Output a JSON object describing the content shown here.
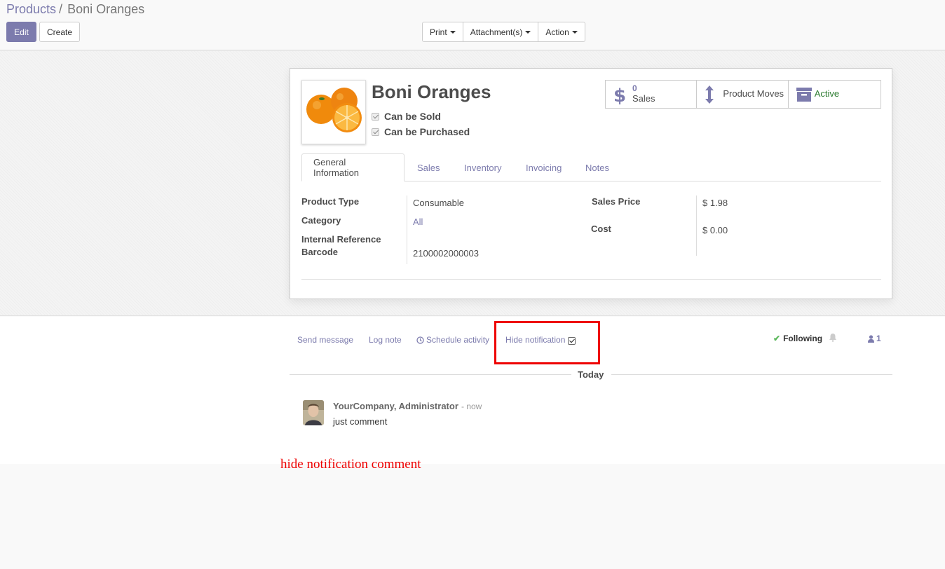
{
  "breadcrumb": {
    "parent": "Products",
    "separator": "/",
    "current": "Boni Oranges"
  },
  "toolbar": {
    "edit": "Edit",
    "create": "Create",
    "print": "Print",
    "attachments": "Attachment(s)",
    "action": "Action"
  },
  "product": {
    "name": "Boni Oranges",
    "can_be_sold": "Can be Sold",
    "can_be_purchased": "Can be Purchased"
  },
  "smart_buttons": {
    "sales_count": "0",
    "sales_label": "Sales",
    "moves_label": "Product Moves",
    "active_label": "Active"
  },
  "tabs": [
    "General Information",
    "Sales",
    "Inventory",
    "Invoicing",
    "Notes"
  ],
  "fields": {
    "product_type_label": "Product Type",
    "product_type_value": "Consumable",
    "category_label": "Category",
    "category_value": "All",
    "internal_ref_label": "Internal Reference",
    "barcode_label": "Barcode",
    "barcode_value": "2100002000003",
    "sales_price_label": "Sales Price",
    "sales_price_value": "$ 1.98",
    "cost_label": "Cost",
    "cost_value": "$ 0.00"
  },
  "chatter": {
    "send_message": "Send message",
    "log_note": "Log note",
    "schedule_activity": "Schedule activity",
    "hide_notification": "Hide notification",
    "following": "Following",
    "followers_count": "1",
    "today": "Today",
    "message": {
      "author": "YourCompany, Administrator",
      "date": "- now",
      "body": "just comment"
    }
  },
  "annotation": "hide notification comment",
  "colors": {
    "accent": "#7c7bad",
    "highlight_box": "#ee0000",
    "active": "#2e7d32"
  }
}
